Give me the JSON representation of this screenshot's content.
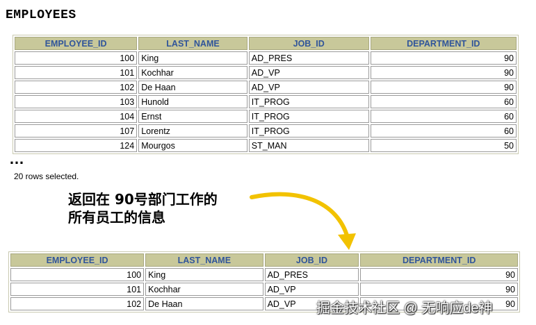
{
  "title": "EMPLOYEES",
  "columns": [
    "EMPLOYEE_ID",
    "LAST_NAME",
    "JOB_ID",
    "DEPARTMENT_ID"
  ],
  "table1_rows": [
    [
      "100",
      "King",
      "AD_PRES",
      "90"
    ],
    [
      "101",
      "Kochhar",
      "AD_VP",
      "90"
    ],
    [
      "102",
      "De Haan",
      "AD_VP",
      "90"
    ],
    [
      "103",
      "Hunold",
      "IT_PROG",
      "60"
    ],
    [
      "104",
      "Ernst",
      "IT_PROG",
      "60"
    ],
    [
      "107",
      "Lorentz",
      "IT_PROG",
      "60"
    ],
    [
      "124",
      "Mourgos",
      "ST_MAN",
      "50"
    ]
  ],
  "ellipsis": "…",
  "rows_selected": "20 rows selected.",
  "caption": {
    "line1": "返回在 90号部门工作的",
    "line2": "所有员工的信息"
  },
  "table2_rows": [
    [
      "100",
      "King",
      "AD_PRES",
      "90"
    ],
    [
      "101",
      "Kochhar",
      "AD_VP",
      "90"
    ],
    [
      "102",
      "De Haan",
      "AD_VP",
      "90"
    ]
  ],
  "watermark": "掘金技术社区 @ 无响应de神",
  "colors": {
    "header_bg": "#c8c89a",
    "header_text": "#30559a",
    "arrow": "#f2c200"
  }
}
